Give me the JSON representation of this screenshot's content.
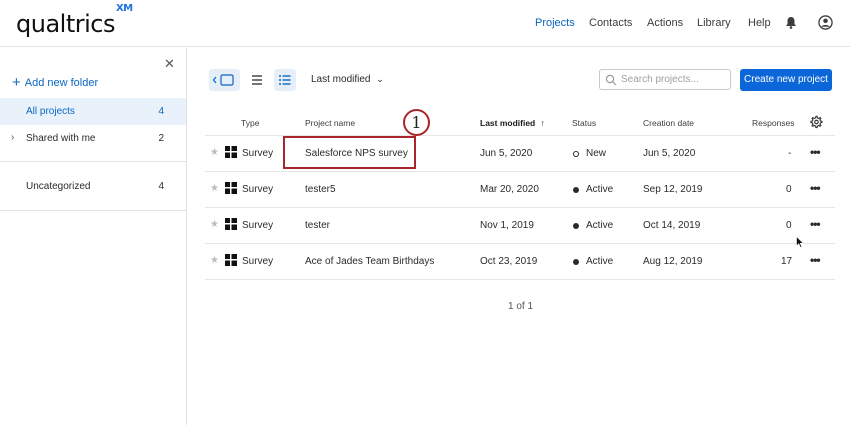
{
  "app": {
    "logo": "qualtrics",
    "logo_sup": "XM"
  },
  "nav": {
    "projects": "Projects",
    "contacts": "Contacts",
    "actions": "Actions",
    "library": "Library",
    "help": "Help"
  },
  "colors": {
    "accent": "#0b66c3",
    "highlight": "#a8262b",
    "primary_button": "#0b66d9"
  },
  "sidebar": {
    "add_folder": "Add new folder",
    "items": [
      {
        "label": "All projects",
        "count": "4"
      },
      {
        "label": "Shared with me",
        "count": "2"
      },
      {
        "label": "Uncategorized",
        "count": "4"
      }
    ]
  },
  "toolbar": {
    "sort_label": "Last modified",
    "search_placeholder": "Search projects...",
    "create_label": "Create new project"
  },
  "table": {
    "headers": {
      "type": "Type",
      "name": "Project name",
      "modified": "Last modified",
      "status": "Status",
      "created": "Creation date",
      "responses": "Responses"
    },
    "rows": [
      {
        "type": "Survey",
        "name": "Salesforce NPS survey",
        "modified": "Jun 5, 2020",
        "status": "New",
        "created": "Jun 5, 2020",
        "responses": "-"
      },
      {
        "type": "Survey",
        "name": "tester5",
        "modified": "Mar 20, 2020",
        "status": "Active",
        "created": "Sep 12, 2019",
        "responses": "0"
      },
      {
        "type": "Survey",
        "name": "tester",
        "modified": "Nov 1, 2019",
        "status": "Active",
        "created": "Oct 14, 2019",
        "responses": "0"
      },
      {
        "type": "Survey",
        "name": "Ace of Jades Team Birthdays",
        "modified": "Oct 23, 2019",
        "status": "Active",
        "created": "Aug 12, 2019",
        "responses": "17"
      }
    ]
  },
  "annotation": {
    "callout_number": "1"
  },
  "pager": "1 of 1"
}
